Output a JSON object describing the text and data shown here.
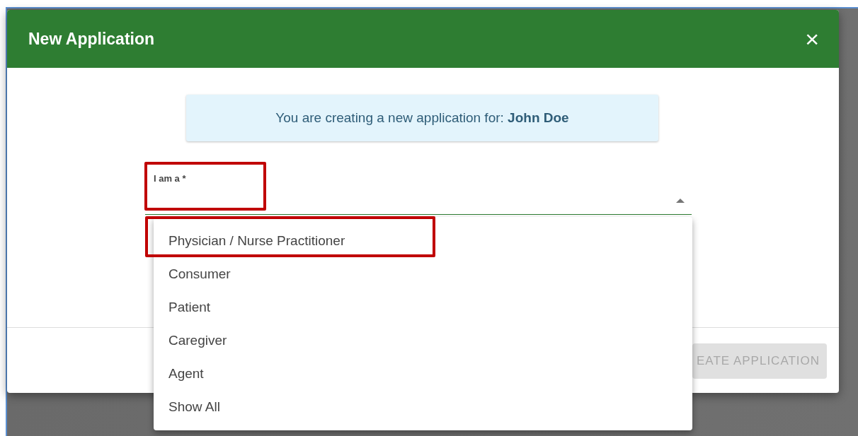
{
  "dialog": {
    "title": "New Application",
    "close": "×"
  },
  "notice": "You are creating a new application for: **John Doe**",
  "field": {
    "label": "I am a *",
    "expanded": true,
    "highlighted": true
  },
  "options": [
    {
      "label": "Physician / Nurse Practitioner",
      "highlighted": true
    },
    {
      "label": "Consumer",
      "highlighted": false
    },
    {
      "label": "Patient",
      "highlighted": false
    },
    {
      "label": "Caregiver",
      "highlighted": false
    },
    {
      "label": "Agent",
      "highlighted": false
    },
    {
      "label": "Show All",
      "highlighted": false
    }
  ],
  "footer": {
    "button": {
      "label": "EATE APPLICATION",
      "disabled": true
    }
  }
}
